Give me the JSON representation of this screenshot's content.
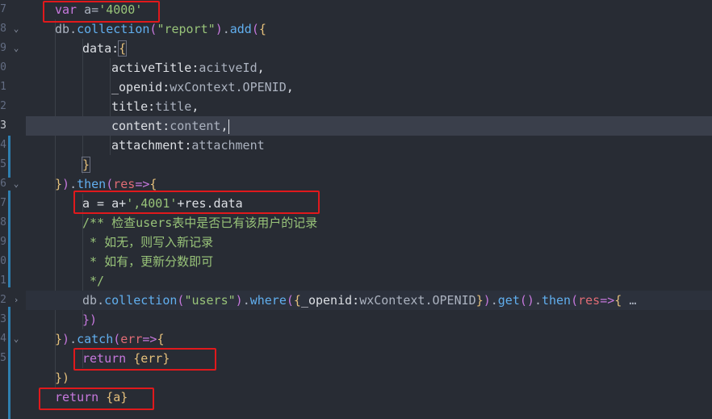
{
  "line_numbers": [
    "7",
    "8",
    "9",
    "0",
    "1",
    "2",
    "3",
    "4",
    "5",
    "6",
    "7",
    "8",
    "9",
    "0",
    "1",
    "2",
    "3",
    "4",
    "5"
  ],
  "code": {
    "l1": {
      "kw": "var",
      "id": " a=",
      "str": "'4000'"
    },
    "l2": {
      "obj": "db",
      "dot": ".",
      "fn": "collection",
      "p1": "(",
      "str": "\"report\"",
      "p2": ")",
      "dot2": ".",
      "fn2": "add",
      "p3": "(",
      "b": "{"
    },
    "l3": {
      "key": "data",
      "colon": ":",
      "b": "{"
    },
    "l4": {
      "key": "activeTitle",
      "colon": ":",
      "val": "acitveId",
      "comma": ","
    },
    "l5": {
      "key": "_openid",
      "colon": ":",
      "val": "wxContext.OPENID",
      "comma": ","
    },
    "l6": {
      "key": "title",
      "colon": ":",
      "val": "title",
      "comma": ","
    },
    "l7": {
      "key": "content",
      "colon": ":",
      "val": "content",
      "comma": ","
    },
    "l8": {
      "key": "attachment",
      "colon": ":",
      "val": "attachment"
    },
    "l9": {
      "b": "}"
    },
    "l10": {
      "b": "}",
      "p": ")",
      "dot": ".",
      "fn": "then",
      "p2": "(",
      "arg": "res",
      "arrow": "=>",
      "b2": "{"
    },
    "l11": {
      "a": "a = a+",
      "str": "',4001'",
      "rest": "+res.data"
    },
    "l12": {
      "text": "/** 检查users表中是否已有该用户的记录"
    },
    "l13": {
      "text": " * 如无，则写入新记录"
    },
    "l14": {
      "text": " * 如有，更新分数即可"
    },
    "l15": {
      "text": " */"
    },
    "l16": {
      "obj": "db",
      "dot": ".",
      "fn": "collection",
      "p1": "(",
      "str": "\"users\"",
      "p2": ")",
      "dot2": ".",
      "fn2": "where",
      "p3": "(",
      "b": "{",
      "key": "_openid",
      "colon": ":",
      "val": "wxContext.OPENID",
      "b2": "}",
      "p4": ")",
      "dot3": ".",
      "fn3": "get",
      "p5": "()",
      "dot4": ".",
      "fn4": "then",
      "p6": "(",
      "arg": "res",
      "arrow": "=>",
      "b3": "{",
      "ellipsis": " …"
    },
    "l17": {
      "b": "})"
    },
    "l18": {
      "b": "}",
      "p": ")",
      "dot": ".",
      "fn": "catch",
      "p2": "(",
      "arg": "err",
      "arrow": "=>",
      "b2": "{"
    },
    "l19": {
      "kw": "return",
      "b": " {err}"
    },
    "l20": {
      "b": "})"
    },
    "l21": {
      "kw": "return",
      "b": " {a}"
    }
  }
}
